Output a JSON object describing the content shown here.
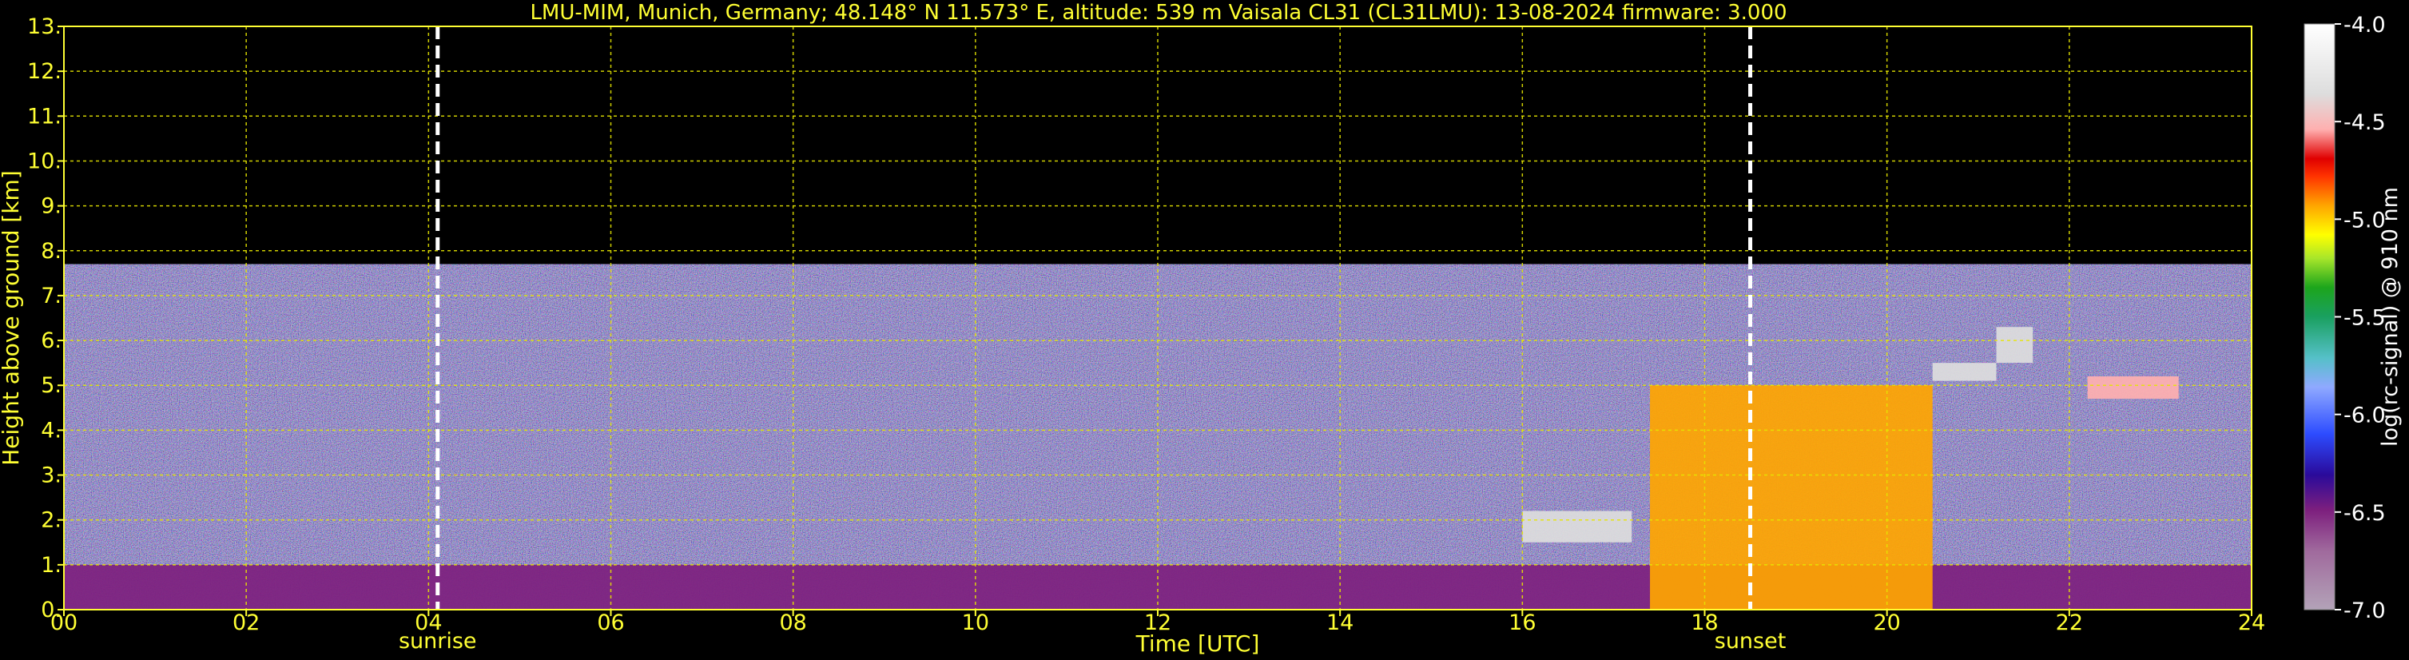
{
  "header": {
    "title": "LMU-MIM, Munich, Germany; 48.148° N 11.573° E, altitude: 539 m    Vaisala CL31 (CL31LMU): 13-08-2024    firmware: 3.000"
  },
  "chart_data": {
    "type": "heatmap",
    "title": "LMU-MIM, Munich, Germany; 48.148° N 11.573° E, altitude: 539 m    Vaisala CL31 (CL31LMU): 13-08-2024    firmware: 3.000",
    "xlabel": "Time [UTC]",
    "ylabel": "Height above ground [km]",
    "xlim": [
      0,
      24
    ],
    "ylim": [
      0,
      13
    ],
    "x_ticks": [
      0,
      2,
      4,
      6,
      8,
      10,
      12,
      14,
      16,
      18,
      20,
      22,
      24
    ],
    "x_tick_labels": [
      "00",
      "02",
      "04",
      "06",
      "08",
      "10",
      "12",
      "14",
      "16",
      "18",
      "20",
      "22",
      "24"
    ],
    "y_ticks": [
      0,
      1,
      2,
      3,
      4,
      5,
      6,
      7,
      8,
      9,
      10,
      11,
      12,
      13
    ],
    "y_tick_labels": [
      "0.",
      "1.",
      "2.",
      "3.",
      "4.",
      "5.",
      "6.",
      "7.",
      "8.",
      "9.",
      "10.",
      "11.",
      "12.",
      "13."
    ],
    "grid": true,
    "markers": [
      {
        "label": "sunrise",
        "time": 4.1
      },
      {
        "label": "sunset",
        "time": 18.5
      }
    ],
    "data_top_km": 7.7,
    "colorbar": {
      "label": "log(rc-signal) @ 910 nm",
      "range": [
        -7.0,
        -4.0
      ],
      "ticks": [
        -7.0,
        -6.5,
        -6.0,
        -5.5,
        -5.0,
        -4.5,
        -4.0
      ],
      "tick_labels": [
        "-7.0",
        "-6.5",
        "-6.0",
        "-5.5",
        "-5.0",
        "-4.5",
        "-4.0"
      ]
    },
    "features": [
      {
        "name": "boundary layer aerosol",
        "x_range": [
          0,
          24
        ],
        "height_range": [
          0,
          1.0
        ],
        "level": -6.4
      },
      {
        "name": "low cloud",
        "x_range": [
          16.0,
          17.2
        ],
        "height_range": [
          1.5,
          2.2
        ],
        "level": -4.3
      },
      {
        "name": "convective cloud / precipitation",
        "x_range": [
          17.4,
          20.5
        ],
        "height_range": [
          0,
          5.0
        ],
        "level": -4.8
      },
      {
        "name": "mid-level cloud",
        "x_range": [
          20.5,
          21.2
        ],
        "height_range": [
          5.1,
          5.5
        ],
        "level": -4.3
      },
      {
        "name": "mid-level cloud",
        "x_range": [
          21.2,
          21.6
        ],
        "height_range": [
          5.5,
          6.3
        ],
        "level": -4.3
      },
      {
        "name": "mid-level cloud",
        "x_range": [
          22.2,
          23.2
        ],
        "height_range": [
          4.7,
          5.2
        ],
        "level": -4.4
      }
    ]
  }
}
